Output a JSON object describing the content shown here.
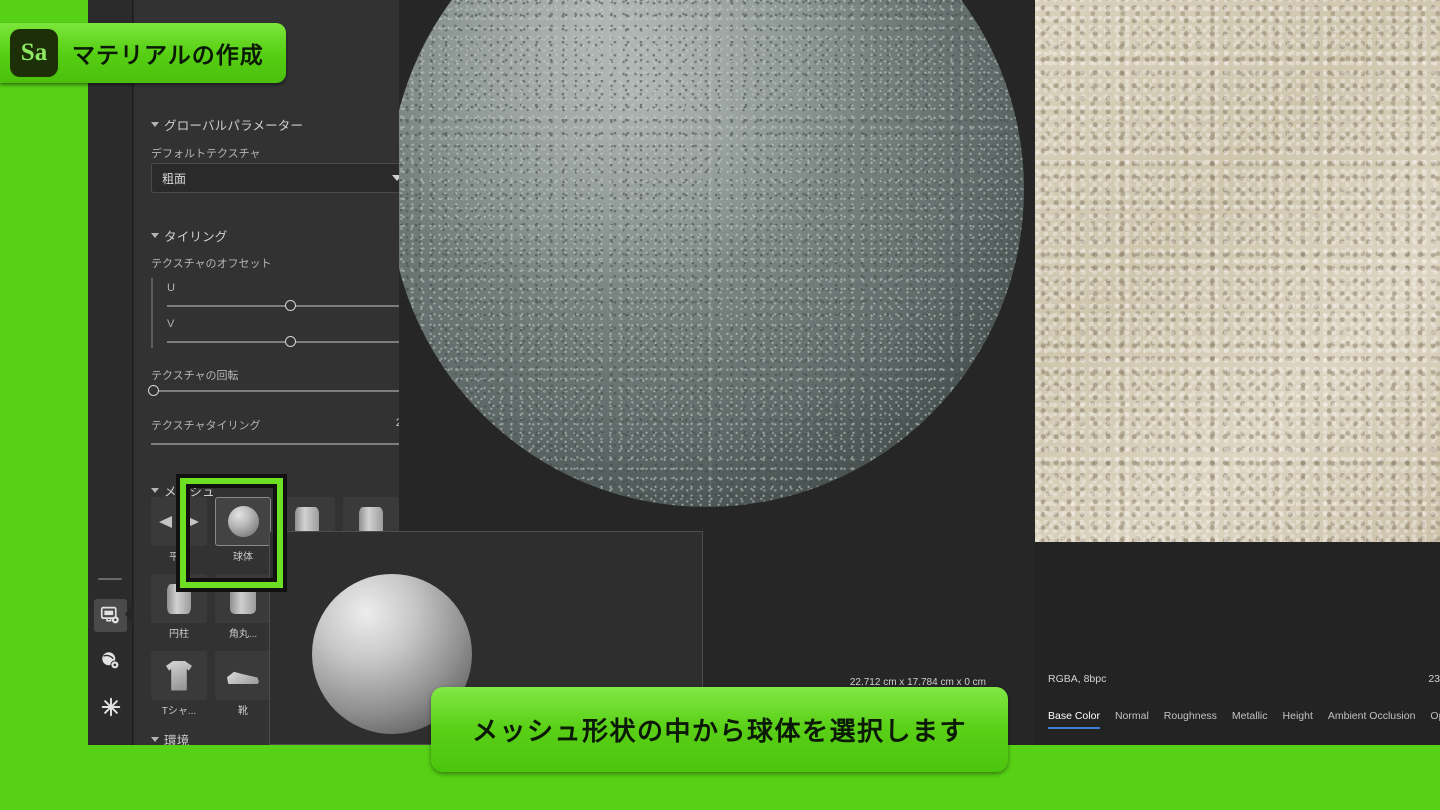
{
  "title_badge": {
    "logo": "Sa",
    "text": "マテリアルの作成"
  },
  "caption": {
    "text": "メッシュ形状の中から球体を選択します"
  },
  "rail": {
    "items": [
      {
        "name": "display-settings",
        "glyph": "display-gear-icon"
      },
      {
        "name": "material-settings",
        "glyph": "sphere-gear-icon"
      },
      {
        "name": "effects",
        "glyph": "snowflake-icon"
      }
    ]
  },
  "properties_panel": {
    "sections": [
      {
        "title": "グローバルパラメーター"
      },
      {
        "title": "タイリング"
      },
      {
        "title": "メッシュ"
      },
      {
        "title": "環境"
      }
    ],
    "default_texture": {
      "label": "デフォルトテクスチャ",
      "value": "粗面"
    },
    "texture_offset": {
      "label": "テクスチャのオフセット",
      "u": {
        "label": "U",
        "value": "0"
      },
      "v": {
        "label": "V",
        "value": "0.01"
      }
    },
    "texture_rotation": {
      "label": "テクスチャの回転",
      "value": "0"
    },
    "texture_tiling": {
      "label": "テクスチャタイリング",
      "value": "2",
      "link_icon": "link-icon"
    }
  },
  "mesh_grid": {
    "items": [
      {
        "label": "平面",
        "shape": "plane",
        "selected": false
      },
      {
        "label": "球体",
        "shape": "sphere",
        "selected": true
      },
      {
        "label": "円柱",
        "shape": "cylinder",
        "selected": false
      },
      {
        "label": "角丸...",
        "shape": "cube",
        "selected": false
      },
      {
        "label": "Tシャ...",
        "shape": "shirt",
        "selected": false
      },
      {
        "label": "靴",
        "shape": "shoe",
        "selected": false
      }
    ]
  },
  "viewport": {
    "dimensions": "22.712 cm x 17.784 cm x 0 cm"
  },
  "texture_panel": {
    "format": "RGBA, 8bpc",
    "size": "23",
    "tabs": [
      {
        "label": "Base Color",
        "active": true
      },
      {
        "label": "Normal",
        "active": false
      },
      {
        "label": "Roughness",
        "active": false
      },
      {
        "label": "Metallic",
        "active": false
      },
      {
        "label": "Height",
        "active": false
      },
      {
        "label": "Ambient Occlusion",
        "active": false
      },
      {
        "label": "Opac",
        "active": false
      }
    ]
  },
  "colors": {
    "accent_green": "#56d115",
    "panel_bg": "#323232",
    "app_bg": "#262626",
    "tab_active": "#3b7fd4"
  }
}
